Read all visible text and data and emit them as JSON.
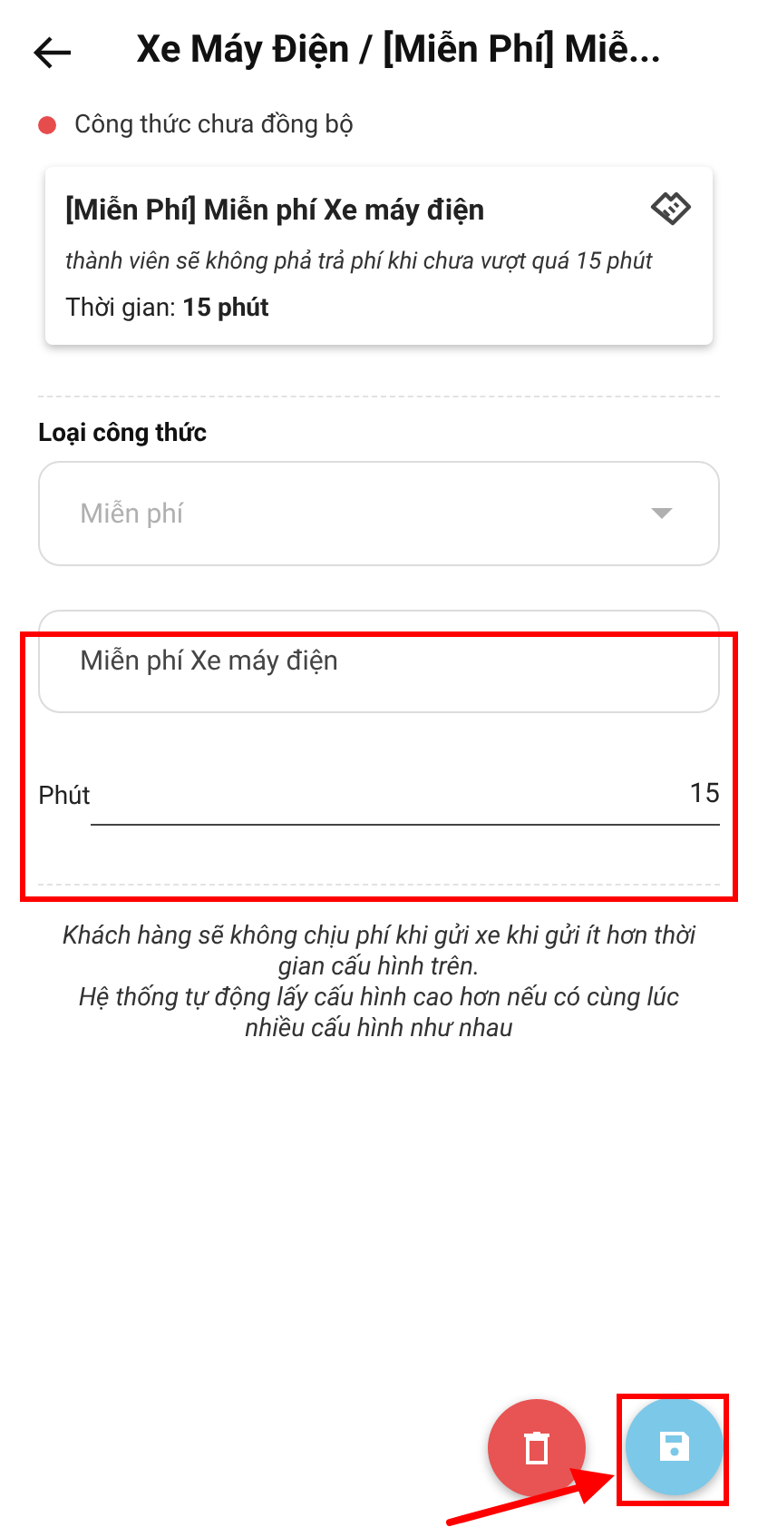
{
  "header": {
    "title": "Xe Máy Điện / [Miễn Phí] Miễ..."
  },
  "status": {
    "text": "Công thức chưa đồng bộ",
    "color": "#e74c4c"
  },
  "summary_card": {
    "title": "[Miễn Phí] Miễn phí Xe máy điện",
    "description": "thành viên sẽ không phả trả phí khi chưa vượt quá 15 phút",
    "duration": "Thời gian: **15 phút**"
  },
  "formula_type": {
    "label": "Loại công thức",
    "value": "Miễn phí",
    "disabled": true
  },
  "name_field": {
    "value": "Miễn phí Xe máy điện"
  },
  "minutes_field": {
    "label": "Phút",
    "value": "15"
  },
  "note": [
    "Khách hàng sẽ không chịu phí khi gửi xe khi gửi ít hơn thời gian cấu hình trên.",
    "Hệ thống tự động lấy cấu hình cao hơn nếu có cùng lúc nhiều cấu hình như nhau"
  ]
}
